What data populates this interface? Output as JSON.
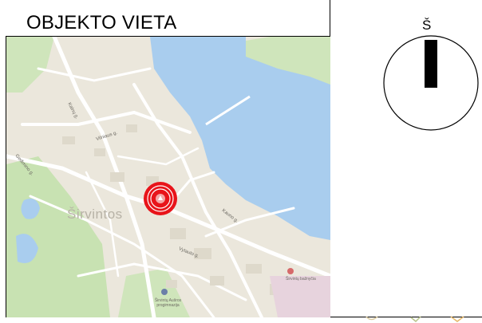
{
  "title": "OBJEKTO VIETA",
  "compass": {
    "label": "Š"
  },
  "map": {
    "town_label": "Širvintos",
    "streets": [
      "Kalnų g.",
      "Vilniaus g.",
      "Gedimino g.",
      "Kauno g.",
      "Vytauto g."
    ],
    "poi_church": "Širvintų bažnyčia",
    "poi_lower": "Širvintų Aušros progimnazija"
  },
  "colors": {
    "water": "#a9cdee",
    "land": "#ebe7dc",
    "park": "#c8e2b2",
    "road": "#ffffff",
    "marker": "#e8141a",
    "marker_icon": "map-pin-icon"
  }
}
